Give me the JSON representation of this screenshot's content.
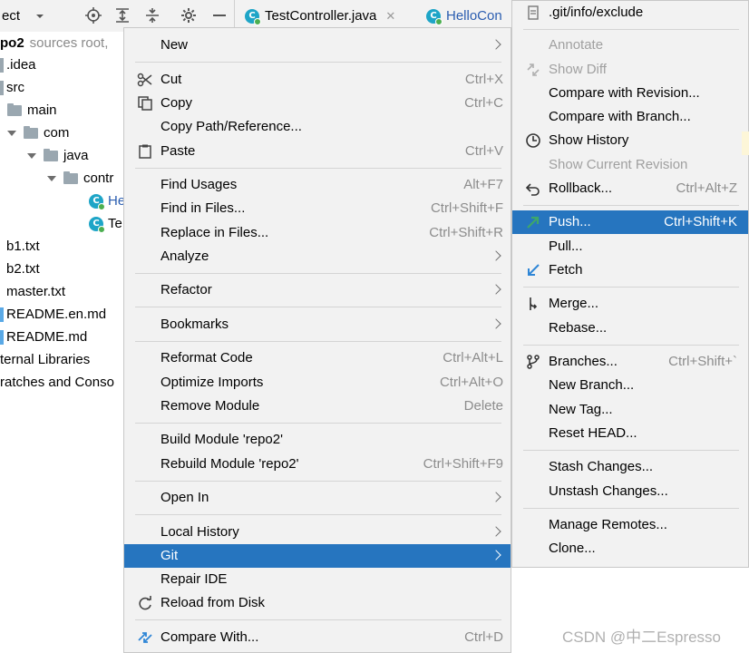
{
  "toolbar": {
    "project_label": "ect",
    "tabs": [
      {
        "label": "TestController.java"
      },
      {
        "label": "HelloCon"
      }
    ]
  },
  "tree": {
    "root": {
      "name": "po2",
      "hint": "sources root,"
    },
    "items": [
      {
        "label": ".idea"
      },
      {
        "label": "src"
      },
      {
        "label": "main"
      },
      {
        "label": "com"
      },
      {
        "label": "java"
      },
      {
        "label": "contr"
      },
      {
        "label": "He"
      },
      {
        "label": "Te"
      },
      {
        "label": "b1.txt"
      },
      {
        "label": "b2.txt"
      },
      {
        "label": "master.txt"
      },
      {
        "label": "README.en.md"
      },
      {
        "label": "README.md"
      },
      {
        "label": "ternal Libraries"
      },
      {
        "label": "ratches and Conso"
      }
    ]
  },
  "menu": {
    "items": [
      {
        "label": "New",
        "shortcut": ""
      },
      {
        "label": "Cut",
        "shortcut": "Ctrl+X"
      },
      {
        "label": "Copy",
        "shortcut": "Ctrl+C"
      },
      {
        "label": "Copy Path/Reference...",
        "shortcut": ""
      },
      {
        "label": "Paste",
        "shortcut": "Ctrl+V"
      },
      {
        "label": "Find Usages",
        "shortcut": "Alt+F7"
      },
      {
        "label": "Find in Files...",
        "shortcut": "Ctrl+Shift+F"
      },
      {
        "label": "Replace in Files...",
        "shortcut": "Ctrl+Shift+R"
      },
      {
        "label": "Analyze",
        "shortcut": ""
      },
      {
        "label": "Refactor",
        "shortcut": ""
      },
      {
        "label": "Bookmarks",
        "shortcut": ""
      },
      {
        "label": "Reformat Code",
        "shortcut": "Ctrl+Alt+L"
      },
      {
        "label": "Optimize Imports",
        "shortcut": "Ctrl+Alt+O"
      },
      {
        "label": "Remove Module",
        "shortcut": "Delete"
      },
      {
        "label": "Build Module 'repo2'",
        "shortcut": ""
      },
      {
        "label": "Rebuild Module 'repo2'",
        "shortcut": "Ctrl+Shift+F9"
      },
      {
        "label": "Open In",
        "shortcut": ""
      },
      {
        "label": "Local History",
        "shortcut": ""
      },
      {
        "label": "Git",
        "shortcut": ""
      },
      {
        "label": "Repair IDE",
        "shortcut": ""
      },
      {
        "label": "Reload from Disk",
        "shortcut": ""
      },
      {
        "label": "Compare With...",
        "shortcut": "Ctrl+D"
      }
    ]
  },
  "git_menu": {
    "items": [
      {
        "label": ".git/info/exclude",
        "shortcut": ""
      },
      {
        "label": "Annotate",
        "shortcut": ""
      },
      {
        "label": "Show Diff",
        "shortcut": ""
      },
      {
        "label": "Compare with Revision...",
        "shortcut": ""
      },
      {
        "label": "Compare with Branch...",
        "shortcut": ""
      },
      {
        "label": "Show History",
        "shortcut": ""
      },
      {
        "label": "Show Current Revision",
        "shortcut": ""
      },
      {
        "label": "Rollback...",
        "shortcut": "Ctrl+Alt+Z"
      },
      {
        "label": "Push...",
        "shortcut": "Ctrl+Shift+K"
      },
      {
        "label": "Pull...",
        "shortcut": ""
      },
      {
        "label": "Fetch",
        "shortcut": ""
      },
      {
        "label": "Merge...",
        "shortcut": ""
      },
      {
        "label": "Rebase...",
        "shortcut": ""
      },
      {
        "label": "Branches...",
        "shortcut": "Ctrl+Shift+`"
      },
      {
        "label": "New Branch...",
        "shortcut": ""
      },
      {
        "label": "New Tag...",
        "shortcut": ""
      },
      {
        "label": "Reset HEAD...",
        "shortcut": ""
      },
      {
        "label": "Stash Changes...",
        "shortcut": ""
      },
      {
        "label": "Unstash Changes...",
        "shortcut": ""
      },
      {
        "label": "Manage Remotes...",
        "shortcut": ""
      },
      {
        "label": "Clone...",
        "shortcut": ""
      }
    ]
  },
  "watermark": "CSDN @中二Espresso",
  "colors": {
    "selection": "#2675bf",
    "menu_bg": "#f2f2f2",
    "accent_green": "#3ea76a"
  }
}
